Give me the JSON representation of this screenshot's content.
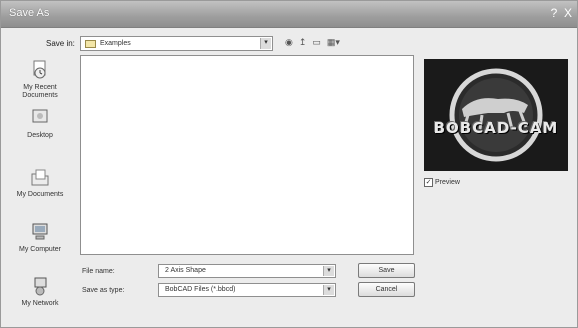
{
  "window": {
    "title": "Save As"
  },
  "titlebar": {
    "help": "?",
    "close": "X"
  },
  "save_in": {
    "label": "Save in:",
    "value": "Examples"
  },
  "places": [
    {
      "label": "My Recent Documents"
    },
    {
      "label": "Desktop"
    },
    {
      "label": "My Documents"
    },
    {
      "label": "My Computer"
    },
    {
      "label": "My Network"
    }
  ],
  "file_name": {
    "label": "File name:",
    "value": "2 Axis Shape"
  },
  "save_as_type": {
    "label": "Save as type:",
    "value": "BobCAD Files (*.bbcd)"
  },
  "buttons": {
    "save": "Save",
    "cancel": "Cancel"
  },
  "preview": {
    "logo_text": "BOBCAD-CAM",
    "checkbox_label": "Preview",
    "checked": true
  }
}
